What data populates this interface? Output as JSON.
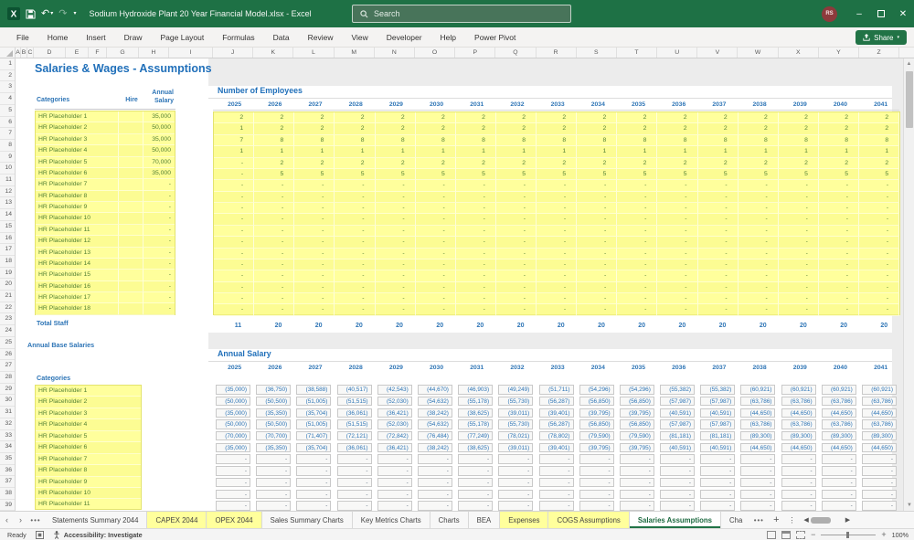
{
  "titlebar": {
    "title": "Sodium Hydroxide Plant 20 Year Financial Model.xlsx  -  Excel",
    "search_placeholder": "Search",
    "avatar_initials": "RS"
  },
  "ribbon": {
    "tabs": [
      "File",
      "Home",
      "Insert",
      "Draw",
      "Page Layout",
      "Formulas",
      "Data",
      "Review",
      "View",
      "Developer",
      "Help",
      "Power Pivot"
    ],
    "share_label": "Share"
  },
  "grid": {
    "column_headers": [
      "A",
      "B",
      "C",
      "D",
      "E",
      "F",
      "G",
      "H",
      "I",
      "J",
      "K",
      "L",
      "M",
      "N",
      "O",
      "P",
      "Q",
      "R",
      "S",
      "T",
      "U",
      "V",
      "W",
      "X",
      "Y",
      "Z"
    ],
    "row_count": 39
  },
  "sheet": {
    "page_title": "Salaries & Wages - Assumptions",
    "staff_table": {
      "header_categories": "Categories",
      "header_hire": "Hire",
      "header_salary_line1": "Annual",
      "header_salary_line2": "Salary",
      "rows": [
        {
          "name": "HR Placeholder 1",
          "hire": "",
          "salary": "35,000"
        },
        {
          "name": "HR Placeholder 2",
          "hire": "",
          "salary": "50,000"
        },
        {
          "name": "HR Placeholder 3",
          "hire": "",
          "salary": "35,000"
        },
        {
          "name": "HR Placeholder 4",
          "hire": "",
          "salary": "50,000"
        },
        {
          "name": "HR Placeholder 5",
          "hire": "",
          "salary": "70,000"
        },
        {
          "name": "HR Placeholder 6",
          "hire": "",
          "salary": "35,000"
        },
        {
          "name": "HR Placeholder 7",
          "hire": "",
          "salary": "-"
        },
        {
          "name": "HR Placeholder 8",
          "hire": "",
          "salary": "-"
        },
        {
          "name": "HR Placeholder 9",
          "hire": "",
          "salary": "-"
        },
        {
          "name": "HR Placeholder 10",
          "hire": "",
          "salary": "-"
        },
        {
          "name": "HR Placeholder 11",
          "hire": "",
          "salary": "-"
        },
        {
          "name": "HR Placeholder 12",
          "hire": "",
          "salary": "-"
        },
        {
          "name": "HR Placeholder 13",
          "hire": "",
          "salary": "-"
        },
        {
          "name": "HR Placeholder 14",
          "hire": "",
          "salary": "-"
        },
        {
          "name": "HR Placeholder 15",
          "hire": "",
          "salary": "-"
        },
        {
          "name": "HR Placeholder 16",
          "hire": "",
          "salary": "-"
        },
        {
          "name": "HR Placeholder 17",
          "hire": "",
          "salary": "-"
        },
        {
          "name": "HR Placeholder 18",
          "hire": "",
          "salary": "-"
        }
      ],
      "total_label": "Total Staff"
    },
    "annual_base_salaries_label": "Annual Base Salaries",
    "base_categories_header": "Categories",
    "base_categories": [
      "HR Placeholder 1",
      "HR Placeholder 2",
      "HR Placeholder 3",
      "HR Placeholder 4",
      "HR Placeholder 5",
      "HR Placeholder 6",
      "HR Placeholder 7",
      "HR Placeholder 8",
      "HR Placeholder 9",
      "HR Placeholder 10",
      "HR Placeholder 11"
    ],
    "years": [
      "2025",
      "2026",
      "2027",
      "2028",
      "2029",
      "2030",
      "2031",
      "2032",
      "2033",
      "2034",
      "2035",
      "2036",
      "2037",
      "2038",
      "2039",
      "2040",
      "2041"
    ],
    "employees": {
      "title": "Number of Employees",
      "rows": [
        [
          "2",
          "2",
          "2",
          "2",
          "2",
          "2",
          "2",
          "2",
          "2",
          "2",
          "2",
          "2",
          "2",
          "2",
          "2",
          "2",
          "2"
        ],
        [
          "1",
          "2",
          "2",
          "2",
          "2",
          "2",
          "2",
          "2",
          "2",
          "2",
          "2",
          "2",
          "2",
          "2",
          "2",
          "2",
          "2"
        ],
        [
          "7",
          "8",
          "8",
          "8",
          "8",
          "8",
          "8",
          "8",
          "8",
          "8",
          "8",
          "8",
          "8",
          "8",
          "8",
          "8",
          "8"
        ],
        [
          "1",
          "1",
          "1",
          "1",
          "1",
          "1",
          "1",
          "1",
          "1",
          "1",
          "1",
          "1",
          "1",
          "1",
          "1",
          "1",
          "1"
        ],
        [
          "-",
          "2",
          "2",
          "2",
          "2",
          "2",
          "2",
          "2",
          "2",
          "2",
          "2",
          "2",
          "2",
          "2",
          "2",
          "2",
          "2"
        ],
        [
          "-",
          "5",
          "5",
          "5",
          "5",
          "5",
          "5",
          "5",
          "5",
          "5",
          "5",
          "5",
          "5",
          "5",
          "5",
          "5",
          "5"
        ]
      ],
      "dash_row_count": 12,
      "totals": [
        "11",
        "20",
        "20",
        "20",
        "20",
        "20",
        "20",
        "20",
        "20",
        "20",
        "20",
        "20",
        "20",
        "20",
        "20",
        "20",
        "20"
      ]
    },
    "salaries": {
      "title": "Annual Salary",
      "rows": [
        [
          "(35,000)",
          "(36,750)",
          "(38,588)",
          "(40,517)",
          "(42,543)",
          "(44,670)",
          "(46,903)",
          "(49,249)",
          "(51,711)",
          "(54,296)",
          "(54,296)",
          "(55,382)",
          "(55,382)",
          "(60,921)",
          "(60,921)",
          "(60,921)",
          "(60,921)"
        ],
        [
          "(50,000)",
          "(50,500)",
          "(51,005)",
          "(51,515)",
          "(52,030)",
          "(54,632)",
          "(55,178)",
          "(55,730)",
          "(56,287)",
          "(56,850)",
          "(56,850)",
          "(57,987)",
          "(57,987)",
          "(63,786)",
          "(63,786)",
          "(63,786)",
          "(63,786)"
        ],
        [
          "(35,000)",
          "(35,350)",
          "(35,704)",
          "(36,061)",
          "(36,421)",
          "(38,242)",
          "(38,625)",
          "(39,011)",
          "(39,401)",
          "(39,795)",
          "(39,795)",
          "(40,591)",
          "(40,591)",
          "(44,650)",
          "(44,650)",
          "(44,650)",
          "(44,650)"
        ],
        [
          "(50,000)",
          "(50,500)",
          "(51,005)",
          "(51,515)",
          "(52,030)",
          "(54,632)",
          "(55,178)",
          "(55,730)",
          "(56,287)",
          "(56,850)",
          "(56,850)",
          "(57,987)",
          "(57,987)",
          "(63,786)",
          "(63,786)",
          "(63,786)",
          "(63,786)"
        ],
        [
          "(70,000)",
          "(70,700)",
          "(71,407)",
          "(72,121)",
          "(72,842)",
          "(76,484)",
          "(77,249)",
          "(78,021)",
          "(78,802)",
          "(79,590)",
          "(79,590)",
          "(81,181)",
          "(81,181)",
          "(89,300)",
          "(89,300)",
          "(89,300)",
          "(89,300)"
        ],
        [
          "(35,000)",
          "(35,350)",
          "(35,704)",
          "(36,061)",
          "(36,421)",
          "(38,242)",
          "(38,625)",
          "(39,011)",
          "(39,401)",
          "(39,795)",
          "(39,795)",
          "(40,591)",
          "(40,591)",
          "(44,650)",
          "(44,650)",
          "(44,650)",
          "(44,650)"
        ]
      ],
      "dash_row_count": 5
    }
  },
  "tabbar": {
    "tabs": [
      {
        "label": "Statements Summary 2044",
        "style": "normal"
      },
      {
        "label": "CAPEX 2044",
        "style": "yellow"
      },
      {
        "label": "OPEX 2044",
        "style": "yellow"
      },
      {
        "label": "Sales Summary Charts",
        "style": "normal"
      },
      {
        "label": "Key Metrics Charts",
        "style": "normal"
      },
      {
        "label": "Charts",
        "style": "normal"
      },
      {
        "label": "BEA",
        "style": "normal"
      },
      {
        "label": "Expenses",
        "style": "yellow"
      },
      {
        "label": "COGS Assumptions",
        "style": "yellow"
      },
      {
        "label": "Salaries Assumptions",
        "style": "active"
      },
      {
        "label": "Cha",
        "style": "partial"
      }
    ]
  },
  "statusbar": {
    "ready": "Ready",
    "accessibility": "Accessibility: Investigate",
    "zoom_level": "100%"
  },
  "colors": {
    "titlebar_green": "#1e7145",
    "accent_green": "#217346",
    "input_yellow": "#ffff9c",
    "header_blue": "#2170ba",
    "value_blue": "#2e75b6",
    "text_green": "#538135"
  }
}
